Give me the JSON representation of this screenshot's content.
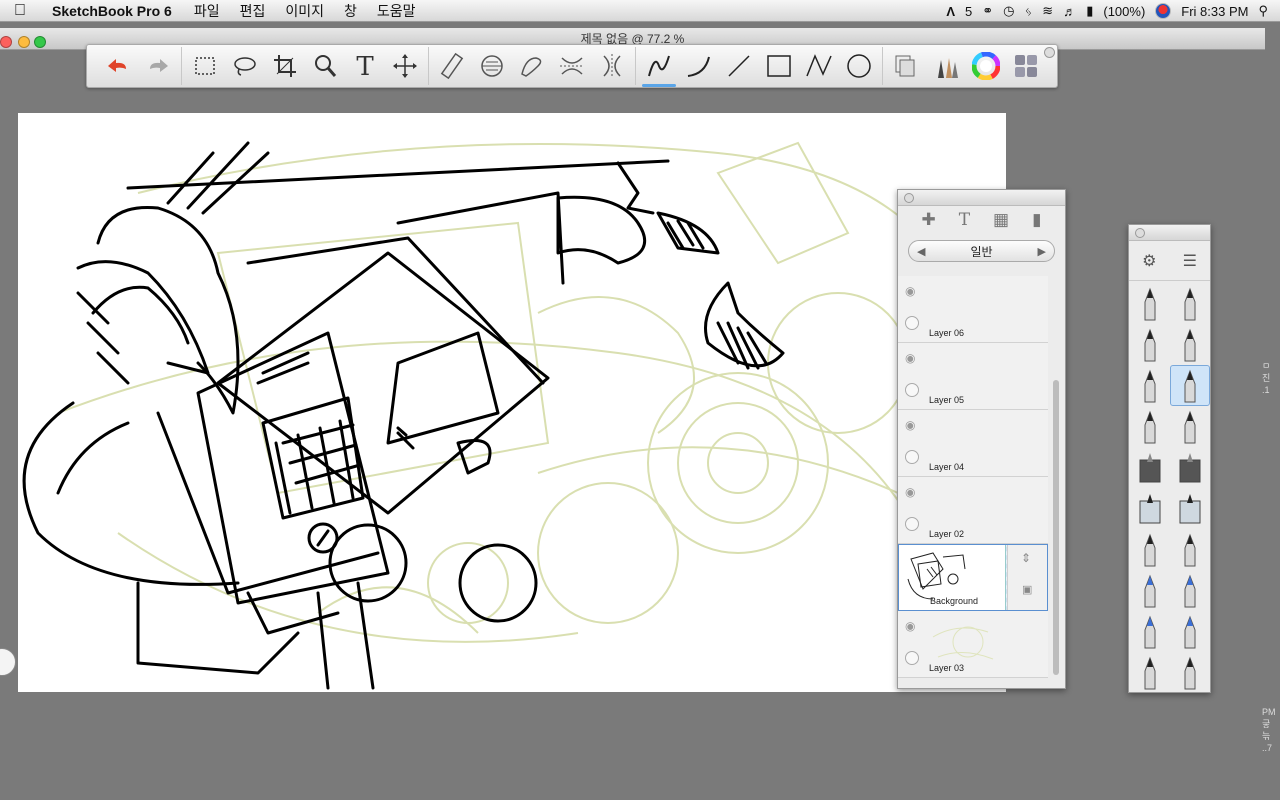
{
  "menubar": {
    "app_name": "SketchBook Pro 6",
    "menus": [
      "파일",
      "편집",
      "이미지",
      "창",
      "도움말"
    ],
    "status": {
      "adobe_count": "5",
      "battery": "(100%)",
      "clock": "Fri 8:33 PM"
    }
  },
  "window": {
    "title": "제목 없음 @ 77.2 %"
  },
  "toolbar": {
    "tools": [
      "undo-icon",
      "redo-icon",
      "rect-select-icon",
      "lasso-icon",
      "crop-icon",
      "zoom-icon",
      "text-icon",
      "move-icon",
      "ruler-icon",
      "ellipse-guide-icon",
      "french-curve-icon",
      "symmetry-x-icon",
      "symmetry-y-icon",
      "stroke-icon",
      "curve-icon",
      "line-icon",
      "rectangle-icon",
      "polyline-icon",
      "ellipse-icon",
      "layers-icon",
      "brushes-icon",
      "color-wheel-icon",
      "palette-icon"
    ],
    "active_tool": "stroke-icon"
  },
  "layers_panel": {
    "blend_mode": "일반",
    "layers": [
      {
        "name": "Layer 06",
        "selected": false
      },
      {
        "name": "Layer 05",
        "selected": false
      },
      {
        "name": "Layer 04",
        "selected": false
      },
      {
        "name": "Layer 02",
        "selected": false
      },
      {
        "name": "Background",
        "selected": true
      },
      {
        "name": "Layer 03",
        "selected": false
      }
    ]
  },
  "brush_palette": {
    "brushes": [
      "pencil",
      "ballpoint",
      "marker",
      "chisel-marker",
      "pen",
      "fine-brush",
      "ink-pen",
      "technical-pen",
      "eraser-hard",
      "eraser-soft",
      "smudge",
      "blur",
      "airbrush",
      "airbrush-fine",
      "blue-marker",
      "blue-pen",
      "blue-felt-tip",
      "blue-ink",
      "paint-brush",
      "bristle-brush"
    ],
    "selected": "fine-brush"
  },
  "edge_text": {
    "right_1": "ㅁ\n진\n.1",
    "right_2": "PM\n긓\n늒\n..7"
  },
  "colors": {
    "sketch_green": "#d9dfb0",
    "ink": "#000000",
    "selection_blue": "#5aa5e8"
  }
}
